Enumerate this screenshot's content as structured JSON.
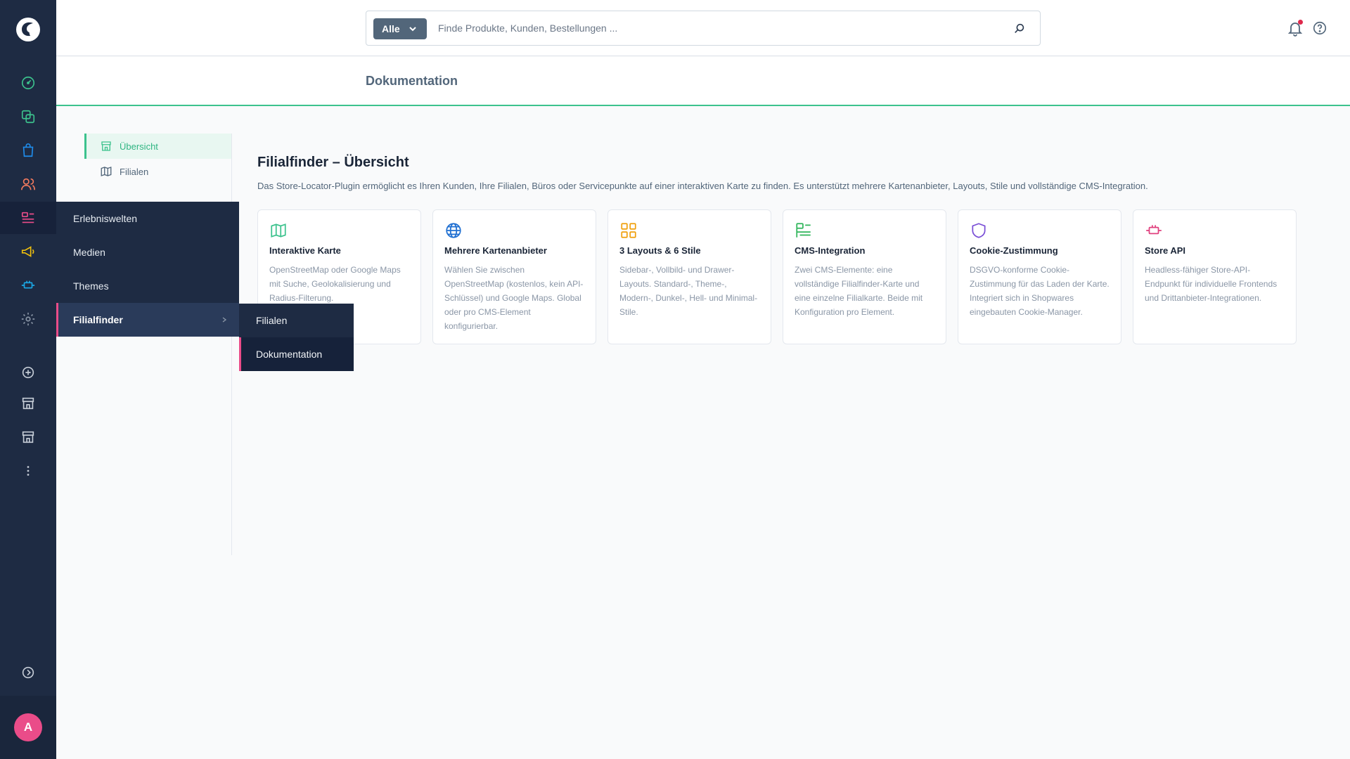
{
  "search": {
    "type_label": "Alle",
    "placeholder": "Finde Produkte, Kunden, Bestellungen ..."
  },
  "page": {
    "title": "Dokumentation"
  },
  "subnav": {
    "items": [
      {
        "label": "Übersicht",
        "icon": "store-icon",
        "active": true
      },
      {
        "label": "Filialen",
        "icon": "map-icon",
        "active": false
      }
    ]
  },
  "flyout": {
    "items": [
      {
        "label": "Erlebniswelten"
      },
      {
        "label": "Medien"
      },
      {
        "label": "Themes"
      },
      {
        "label": "Filialfinder"
      }
    ],
    "submenu": [
      {
        "label": "Filialen"
      },
      {
        "label": "Dokumentation"
      }
    ]
  },
  "main": {
    "title": "Filialfinder – Übersicht",
    "description": "Das Store-Locator-Plugin ermöglicht es Ihren Kunden, Ihre Filialen, Büros oder Servicepunkte auf einer interaktiven Karte zu finden. Es unterstützt mehrere Kartenanbieter, Layouts, Stile und vollständige CMS-Integration.",
    "cards": [
      {
        "title": "Interaktive Karte",
        "text": "OpenStreetMap oder Google Maps mit Suche, Geolokalisierung und Radius-Filterung.",
        "icon": "map-icon",
        "color": "#3cc28d"
      },
      {
        "title": "Mehrere Kartenanbieter",
        "text": "Wählen Sie zwischen OpenStreetMap (kostenlos, kein API-Schlüssel) und Google Maps. Global oder pro CMS-Element konfigurierbar.",
        "icon": "globe-icon",
        "color": "#1f6fd1"
      },
      {
        "title": "3 Layouts & 6 Stile",
        "text": "Sidebar-, Vollbild- und Drawer-Layouts. Standard-, Theme-, Modern-, Dunkel-, Hell- und Minimal-Stile.",
        "icon": "grid-icon",
        "color": "#f0a00d"
      },
      {
        "title": "CMS-Integration",
        "text": "Zwei CMS-Elemente: eine vollständige Filialfinder-Karte und eine einzelne Filialkarte. Beide mit Konfiguration pro Element.",
        "icon": "layout-icon",
        "color": "#2fb55a"
      },
      {
        "title": "Cookie-Zustimmung",
        "text": "DSGVO-konforme Cookie-Zustimmung für das Laden der Karte. Integriert sich in Shopwares eingebauten Cookie-Manager.",
        "icon": "shield-icon",
        "color": "#7a4fd6"
      },
      {
        "title": "Store API",
        "text": "Headless-fähiger Store-API-Endpunkt für individuelle Frontends und Drittanbieter-Integrationen.",
        "icon": "plug-icon",
        "color": "#e0407e"
      }
    ]
  },
  "user": {
    "avatar_initial": "A"
  }
}
